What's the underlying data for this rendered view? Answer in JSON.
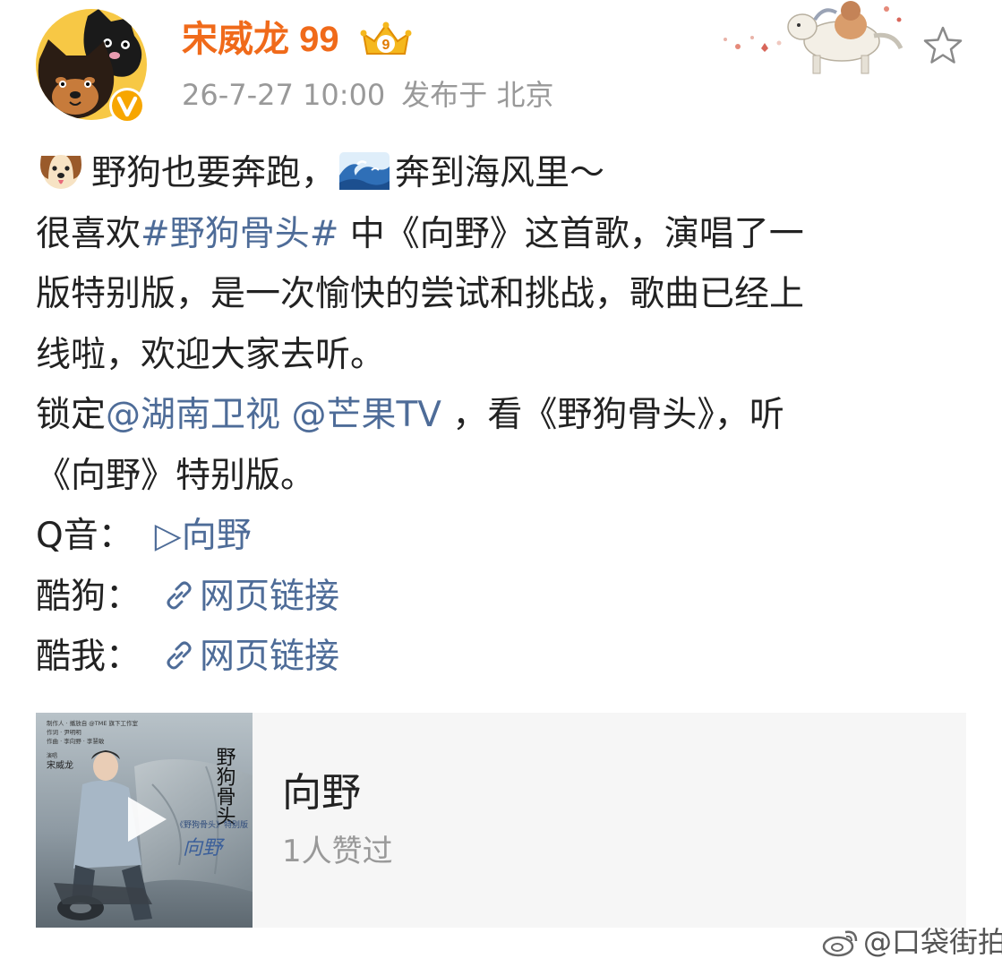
{
  "header": {
    "username": "宋威龙 99",
    "time": "26-7-27 10:00",
    "location": "发布于 北京",
    "vip_crown_number": "9"
  },
  "icons": {
    "avatar": "dog-avatar-icon",
    "verified": "verified-v-icon",
    "crown": "vip-crown-icon",
    "star": "star-outline-icon",
    "link": "link-chain-icon",
    "play": "play-triangle-icon"
  },
  "post": {
    "line1_a": "野狗也要奔跑，",
    "line1_b": "奔到海风里～",
    "line2_a": "很喜欢",
    "line2_hashtag": "#野狗骨头#",
    "line2_b": " 中《向野》这首歌，演唱了一",
    "line3": "版特别版，是一次愉快的尝试和挑战，歌曲已经上",
    "line4": "线啦，欢迎大家去听。",
    "line5_a": "锁定",
    "line5_mention1": "@湖南卫视",
    "line5_mention2": "@芒果TV",
    "line5_b": "，看《野狗骨头》，听",
    "line6": "《向野》特别版。",
    "q_label": "Q音：",
    "q_link": "▷向野",
    "kugou_label": "酷狗：",
    "kugou_link": "网页链接",
    "kuwo_label": "酷我：",
    "kuwo_link": "网页链接"
  },
  "music_card": {
    "title": "向野",
    "likes": "1人赞过",
    "cover_text": {
      "credits": "制作人 · 播放自 @TME 旗下工作室",
      "lyricist": "作词 · 尹明明",
      "composer": "作曲 · 李向野 · 李慧敏",
      "singer_label": "演唱",
      "singer": "宋威龙",
      "show_title": "野狗骨头",
      "edition": "《野狗骨头》特别版",
      "song_calligraphy": "向野"
    }
  },
  "watermark": "@口袋街拍",
  "colors": {
    "username": "#f06a1a",
    "link": "#4e6c98",
    "meta": "#999999",
    "card_bg": "#f6f6f6"
  }
}
